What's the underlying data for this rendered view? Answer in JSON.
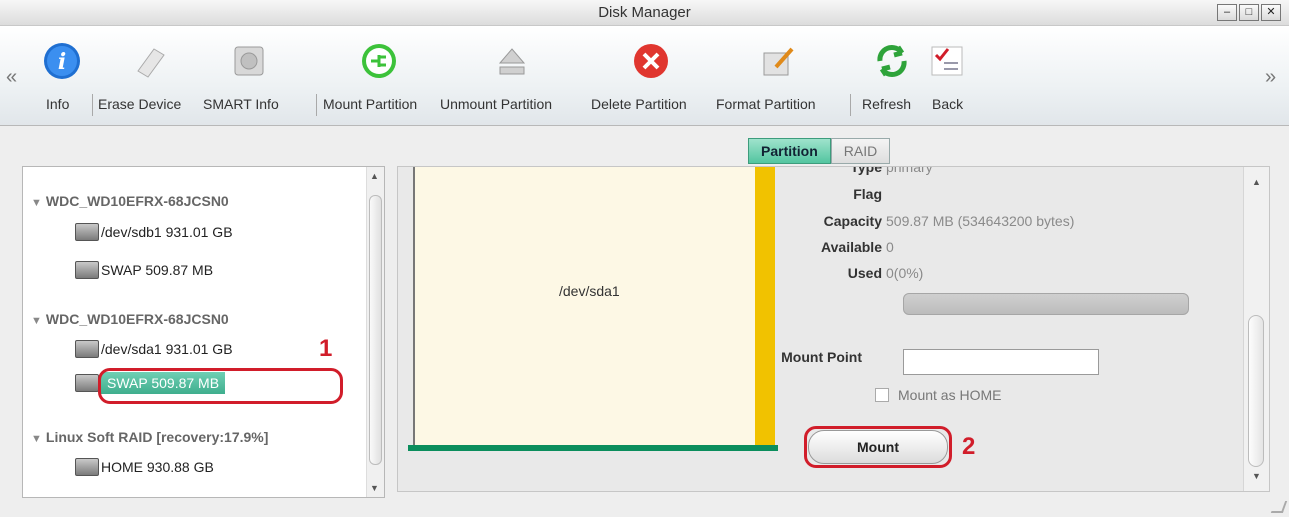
{
  "window": {
    "title": "Disk Manager",
    "controls": [
      "minimize",
      "maximize",
      "close"
    ]
  },
  "toolbar": {
    "items": [
      {
        "label": "Info",
        "icon": "info-icon"
      },
      {
        "label": "Erase Device",
        "icon": "eraser-icon"
      },
      {
        "label": "SMART Info",
        "icon": "hard-disk-icon"
      },
      {
        "label": "Mount Partition",
        "icon": "plug-icon"
      },
      {
        "label": "Unmount Partition",
        "icon": "eject-icon"
      },
      {
        "label": "Delete Partition",
        "icon": "delete-icon"
      },
      {
        "label": "Format Partition",
        "icon": "format-icon"
      },
      {
        "label": "Refresh",
        "icon": "refresh-icon"
      },
      {
        "label": "Back",
        "icon": "checklist-icon"
      }
    ],
    "left_arrow": "«",
    "right_arrow": "»"
  },
  "tabs": [
    {
      "label": "Partition",
      "active": true
    },
    {
      "label": "RAID",
      "active": false
    }
  ],
  "tree": {
    "groups": [
      {
        "name": "WDC_WD10EFRX-68JCSN0",
        "items": [
          "/dev/sdb1 931.01 GB",
          "SWAP 509.87 MB"
        ]
      },
      {
        "name": "WDC_WD10EFRX-68JCSN0",
        "items": [
          "/dev/sda1 931.01 GB",
          "SWAP 509.87 MB"
        ]
      },
      {
        "name": "Linux Soft RAID [recovery:17.9%]",
        "items": [
          "HOME 930.88 GB"
        ]
      }
    ],
    "selected": "SWAP 509.87 MB"
  },
  "partition_map": {
    "label": "/dev/sda1"
  },
  "properties": {
    "type_label": "Type",
    "type_value": "primary",
    "flag_label": "Flag",
    "flag_value": "",
    "capacity_label": "Capacity",
    "capacity_value": "509.87 MB (534643200 bytes)",
    "available_label": "Available",
    "available_value": "0",
    "used_label": "Used",
    "used_value": "0(0%)",
    "used_fraction": 0,
    "mount_point_label": "Mount Point",
    "mount_point_value": "",
    "mount_as_home_label": "Mount as HOME",
    "mount_as_home_checked": false,
    "mount_button": "Mount"
  },
  "annotations": {
    "one": "1",
    "two": "2"
  },
  "colors": {
    "accent_green": "#3fae8d",
    "partition_yellow": "#f1c200",
    "annotation_red": "#d11d2a"
  }
}
